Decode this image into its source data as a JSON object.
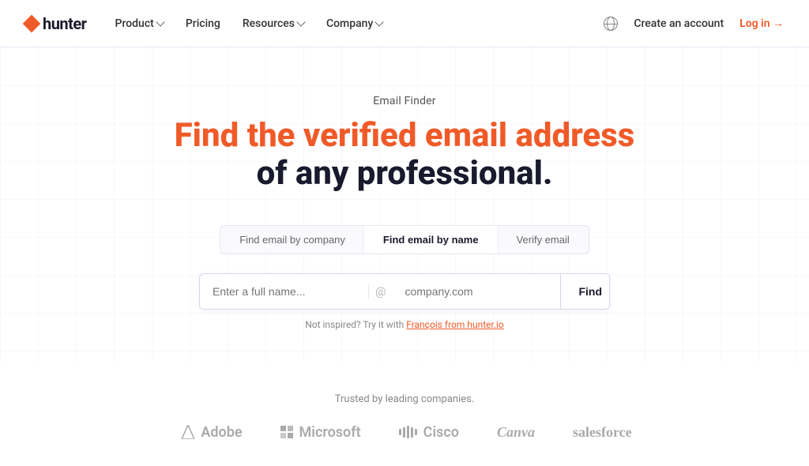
{
  "nav": {
    "logo_text": "hunter",
    "links": [
      {
        "label": "Product",
        "has_dropdown": true
      },
      {
        "label": "Pricing",
        "has_dropdown": false
      },
      {
        "label": "Resources",
        "has_dropdown": true
      },
      {
        "label": "Company",
        "has_dropdown": true
      }
    ],
    "create_account": "Create an account",
    "login": "Log in →"
  },
  "hero": {
    "subtitle": "Email Finder",
    "title_line1": "Find the verified email address",
    "title_line2": "of any professional."
  },
  "tabs": [
    {
      "label": "Find email by company",
      "active": false
    },
    {
      "label": "Find email by name",
      "active": true
    },
    {
      "label": "Verify email",
      "active": false
    }
  ],
  "form": {
    "name_placeholder": "Enter a full name...",
    "domain_placeholder": "company.com",
    "find_button": "Find",
    "hint_prefix": "Not inspired? Try it with ",
    "hint_link": "François from hunter.io",
    "hint_suffix": ""
  },
  "trusted": {
    "label": "Trusted by leading companies.",
    "companies": [
      {
        "name": "Adobe",
        "icon": "adobe"
      },
      {
        "name": "Microsoft",
        "icon": "microsoft"
      },
      {
        "name": "Cisco",
        "icon": "cisco"
      },
      {
        "name": "Canva",
        "icon": "canva"
      },
      {
        "name": "salesforce",
        "icon": "salesforce"
      }
    ]
  }
}
